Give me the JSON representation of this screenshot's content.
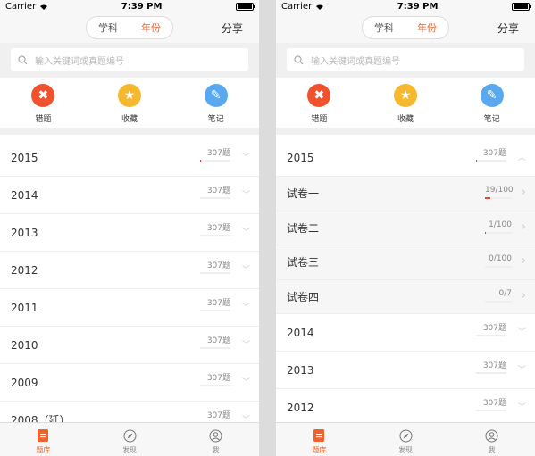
{
  "colors": {
    "accent": "#f0622d",
    "wrong": "#f0522e",
    "favorite": "#f5b82e",
    "notes": "#5aa9f0",
    "progress": "#e0473c"
  },
  "status": {
    "carrier": "Carrier",
    "time": "7:39 PM"
  },
  "nav": {
    "segments": [
      "学科",
      "年份"
    ],
    "active_segment": 1,
    "share": "分享"
  },
  "search": {
    "placeholder": "输入关键词或真题编号",
    "icon": "search-icon"
  },
  "shortcuts": [
    {
      "label": "错题",
      "icon": "close-icon"
    },
    {
      "label": "收藏",
      "icon": "star-icon"
    },
    {
      "label": "笔记",
      "icon": "pencil-icon"
    }
  ],
  "left_list": [
    {
      "year": "2015",
      "count": "307题",
      "progress": 0.03
    },
    {
      "year": "2014",
      "count": "307题",
      "progress": 0
    },
    {
      "year": "2013",
      "count": "307题",
      "progress": 0
    },
    {
      "year": "2012",
      "count": "307题",
      "progress": 0
    },
    {
      "year": "2011",
      "count": "307题",
      "progress": 0
    },
    {
      "year": "2010",
      "count": "307题",
      "progress": 0
    },
    {
      "year": "2009",
      "count": "307题",
      "progress": 0
    },
    {
      "year": "2008（延）",
      "count": "307题",
      "progress": 0
    }
  ],
  "right_list": {
    "expanded": {
      "year": "2015",
      "count": "307题",
      "progress": 0.03
    },
    "papers": [
      {
        "name": "试卷一",
        "count": "19/100",
        "progress": 0.19
      },
      {
        "name": "试卷二",
        "count": "1/100",
        "progress": 0.01
      },
      {
        "name": "试卷三",
        "count": "0/100",
        "progress": 0
      },
      {
        "name": "试卷四",
        "count": "0/7",
        "progress": 0
      }
    ],
    "years": [
      {
        "year": "2014",
        "count": "307题",
        "progress": 0
      },
      {
        "year": "2013",
        "count": "307题",
        "progress": 0
      },
      {
        "year": "2012",
        "count": "307题",
        "progress": 0
      }
    ]
  },
  "tabs": [
    {
      "label": "题库",
      "icon": "document-icon"
    },
    {
      "label": "发现",
      "icon": "compass-icon"
    },
    {
      "label": "我",
      "icon": "user-icon"
    }
  ],
  "active_tab": 0
}
